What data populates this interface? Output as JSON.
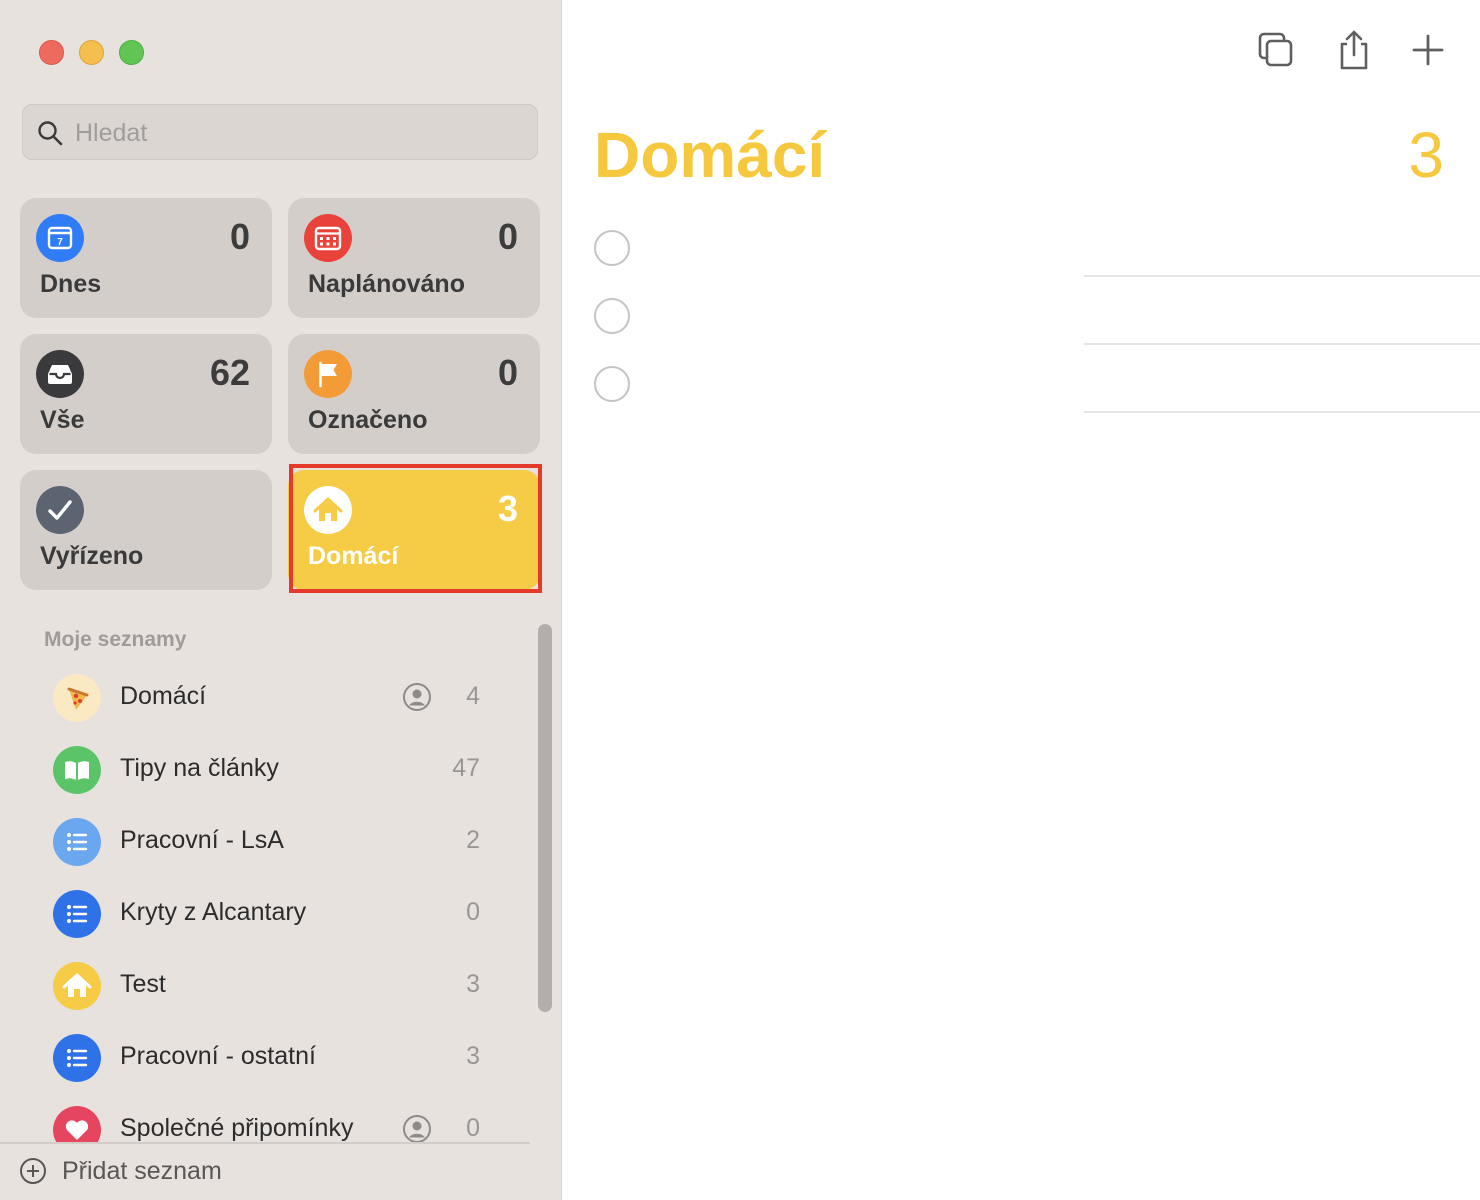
{
  "window": {
    "traffic_lights": [
      "close",
      "minimize",
      "maximize"
    ]
  },
  "sidebar": {
    "search": {
      "placeholder": "Hledat",
      "value": ""
    },
    "smart_lists": [
      {
        "id": "today",
        "label": "Dnes",
        "count": "0",
        "icon": "calendar-icon",
        "color": "#2f7cf6"
      },
      {
        "id": "scheduled",
        "label": "Naplánováno",
        "count": "0",
        "icon": "calendar-grid-icon",
        "color": "#e9423a"
      },
      {
        "id": "all",
        "label": "Vše",
        "count": "62",
        "icon": "tray-icon",
        "color": "#3a3a3c"
      },
      {
        "id": "flagged",
        "label": "Označeno",
        "count": "0",
        "icon": "flag-icon",
        "color": "#f39b36"
      },
      {
        "id": "completed",
        "label": "Vyřízeno",
        "count": "",
        "icon": "checkmark-icon",
        "color": "#5b6470"
      },
      {
        "id": "domaci",
        "label": "Domácí",
        "count": "3",
        "icon": "house-icon",
        "color": "#f6cb45",
        "selected": true
      }
    ],
    "section_title": "Moje seznamy",
    "lists": [
      {
        "name": "Domácí",
        "count": "4",
        "icon": "pizza-icon",
        "color": "#fbe9c4",
        "shared": true
      },
      {
        "name": "Tipy na články",
        "count": "47",
        "icon": "book-icon",
        "color": "#5cc468",
        "shared": false
      },
      {
        "name": "Pracovní - LsA",
        "count": "2",
        "icon": "list-bullet-icon",
        "color": "#6aa7ef",
        "shared": false
      },
      {
        "name": "Kryty z Alcantary",
        "count": "0",
        "icon": "list-bullet-icon",
        "color": "#2f72e8",
        "shared": false
      },
      {
        "name": "Test",
        "count": "3",
        "icon": "house-icon",
        "color": "#f6cb45",
        "shared": false
      },
      {
        "name": "Pracovní - ostatní",
        "count": "3",
        "icon": "list-bullet-icon",
        "color": "#2f72e8",
        "shared": false
      },
      {
        "name": "Společné připomínky",
        "count": "0",
        "icon": "heart-icon",
        "color": "#e5455e",
        "shared": true
      }
    ],
    "add_list_label": "Přidat seznam"
  },
  "main": {
    "toolbar": [
      "duplicate-icon",
      "share-icon",
      "plus-icon"
    ],
    "title": "Domácí",
    "count": "3",
    "accent": "#f6c83d",
    "tasks": [
      {
        "text": ""
      },
      {
        "text": ""
      },
      {
        "text": ""
      }
    ]
  }
}
